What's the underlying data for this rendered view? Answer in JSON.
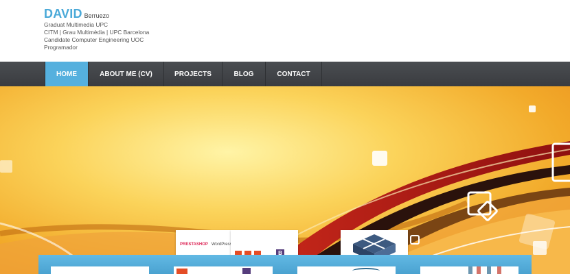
{
  "header": {
    "first_name": "DAVID",
    "last_name": "Berruezo",
    "lines": [
      "Graduat Multimedia UPC",
      "CITM | Grau Multimèdia | UPC Barcelona",
      "Candidate Computer Engineering UOC",
      "Programador"
    ]
  },
  "nav": {
    "items": [
      "HOME",
      "ABOUT ME (CV)",
      "PROJECTS",
      "BLOG",
      "CONTACT"
    ],
    "active": "HOME"
  },
  "thumbs": {
    "prestashop": "PRESTASHOP",
    "wordpress": "WordPress",
    "bootstrap": "B"
  },
  "colors": {
    "brand": "#4aa9d8",
    "nav_bg": "#424549",
    "nav_active": "#55b0de"
  }
}
